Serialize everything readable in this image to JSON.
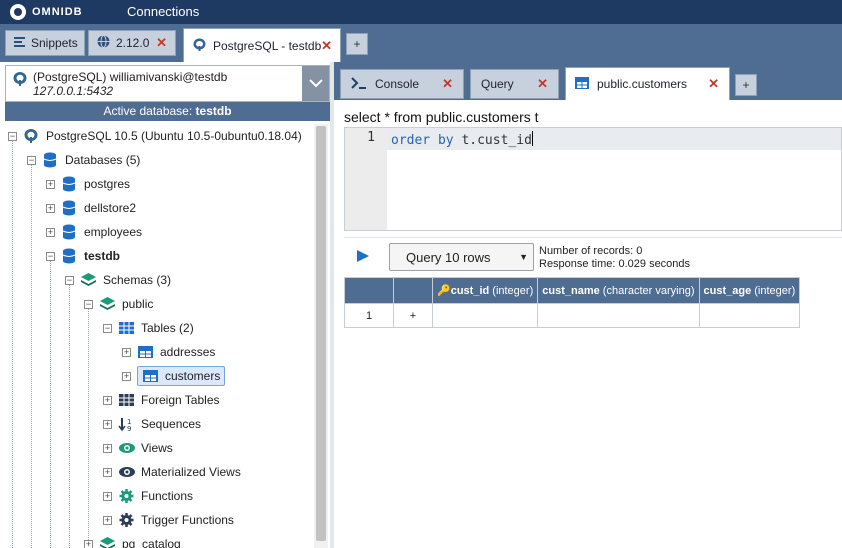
{
  "topbar": {
    "logo_text": "OMNIDB",
    "nav_connections": "Connections"
  },
  "main_tabs": [
    {
      "label": "Snippets",
      "icon": "list-icon"
    },
    {
      "label": "2.12.0",
      "icon": "globe-icon"
    },
    {
      "label": "PostgreSQL - testdb",
      "icon": "postgresql-elephant-icon"
    }
  ],
  "main_add_tab": "+",
  "connection": {
    "name": "(PostgreSQL) williamivanski@testdb",
    "host": "127.0.0.1:5432",
    "active_db_label": "Active database:",
    "active_db_name": "testdb"
  },
  "tree": {
    "server": "PostgreSQL 10.5 (Ubuntu 10.5-0ubuntu0.18.04)",
    "databases": "Databases (5)",
    "db_postgres": "postgres",
    "db_dellstore2": "dellstore2",
    "db_employees": "employees",
    "db_testdb": "testdb",
    "schemas": "Schemas (3)",
    "schema_public": "public",
    "tables": "Tables (2)",
    "table_addresses": "addresses",
    "table_customers": "customers",
    "foreign_tables": "Foreign Tables",
    "sequences": "Sequences",
    "views": "Views",
    "materialized_views": "Materialized Views",
    "functions": "Functions",
    "trigger_functions": "Trigger Functions",
    "pg_catalog": "pg_catalog"
  },
  "sub_tabs": [
    {
      "label": "Console",
      "icon": "terminal-icon"
    },
    {
      "label": "Query"
    },
    {
      "label": "public.customers",
      "icon": "table-icon"
    }
  ],
  "sub_add_tab": "+",
  "editor": {
    "title": "select * from public.customers t",
    "line_number": "1",
    "code_kw1": "order",
    "code_kw2": "by",
    "code_rest": "t.cust_id"
  },
  "query_toolbar": {
    "query_mode": "Query 10 rows",
    "records": "Number of records: 0",
    "response_time": "Response time: 0.029 seconds"
  },
  "grid": {
    "columns": [
      {
        "name": "cust_id",
        "type": "(integer)",
        "key": true
      },
      {
        "name": "cust_name",
        "type": "(character varying)"
      },
      {
        "name": "cust_age",
        "type": "(integer)"
      }
    ],
    "row_number": "1",
    "add_symbol": "+"
  },
  "colors": {
    "topbar": "#1e3a63",
    "tab_strip": "#4f6d93",
    "close": "#c0392b",
    "keyword": "#2b5fb4"
  }
}
